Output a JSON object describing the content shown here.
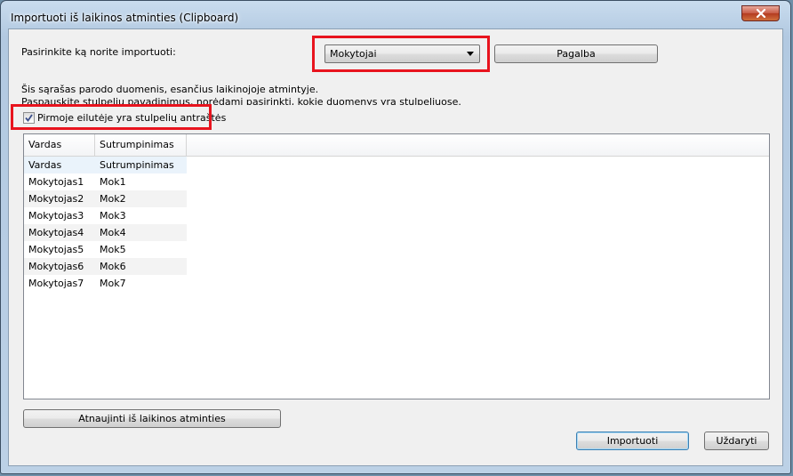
{
  "window": {
    "title": "Importuoti iš laikinos atminties (Clipboard)"
  },
  "form": {
    "prompt_label": "Pasirinkite ką norite importuoti:",
    "select_value": "Mokytojai",
    "help_button": "Pagalba",
    "info_line1": "Šis sąrašas parodo duomenis, esančius laikinojoje atmintyje.",
    "info_line2": "Paspauskite stulpelių pavadinimus, norėdami pasirinkti, kokie duomenys yra stulpeliuose.",
    "checkbox_label": "Pirmoje eilutėje yra stulpelių antraštės",
    "checkbox_checked": true
  },
  "table": {
    "headers": [
      "Vardas",
      "Sutrumpinimas"
    ],
    "rows": [
      [
        "Vardas",
        "Sutrumpinimas"
      ],
      [
        "Mokytojas1",
        "Mok1"
      ],
      [
        "Mokytojas2",
        "Mok2"
      ],
      [
        "Mokytojas3",
        "Mok3"
      ],
      [
        "Mokytojas4",
        "Mok4"
      ],
      [
        "Mokytojas5",
        "Mok5"
      ],
      [
        "Mokytojas6",
        "Mok6"
      ],
      [
        "Mokytojas7",
        "Mok7"
      ]
    ]
  },
  "buttons": {
    "refresh": "Atnaujinti iš laikinos atminties",
    "import": "Importuoti",
    "close": "Uždaryti"
  },
  "colors": {
    "highlight": "#e8141e",
    "selected_row": "#eaf3fb"
  },
  "icons": {
    "close": "close-icon",
    "dropdown": "chevron-down-icon",
    "check": "checkmark-icon"
  }
}
